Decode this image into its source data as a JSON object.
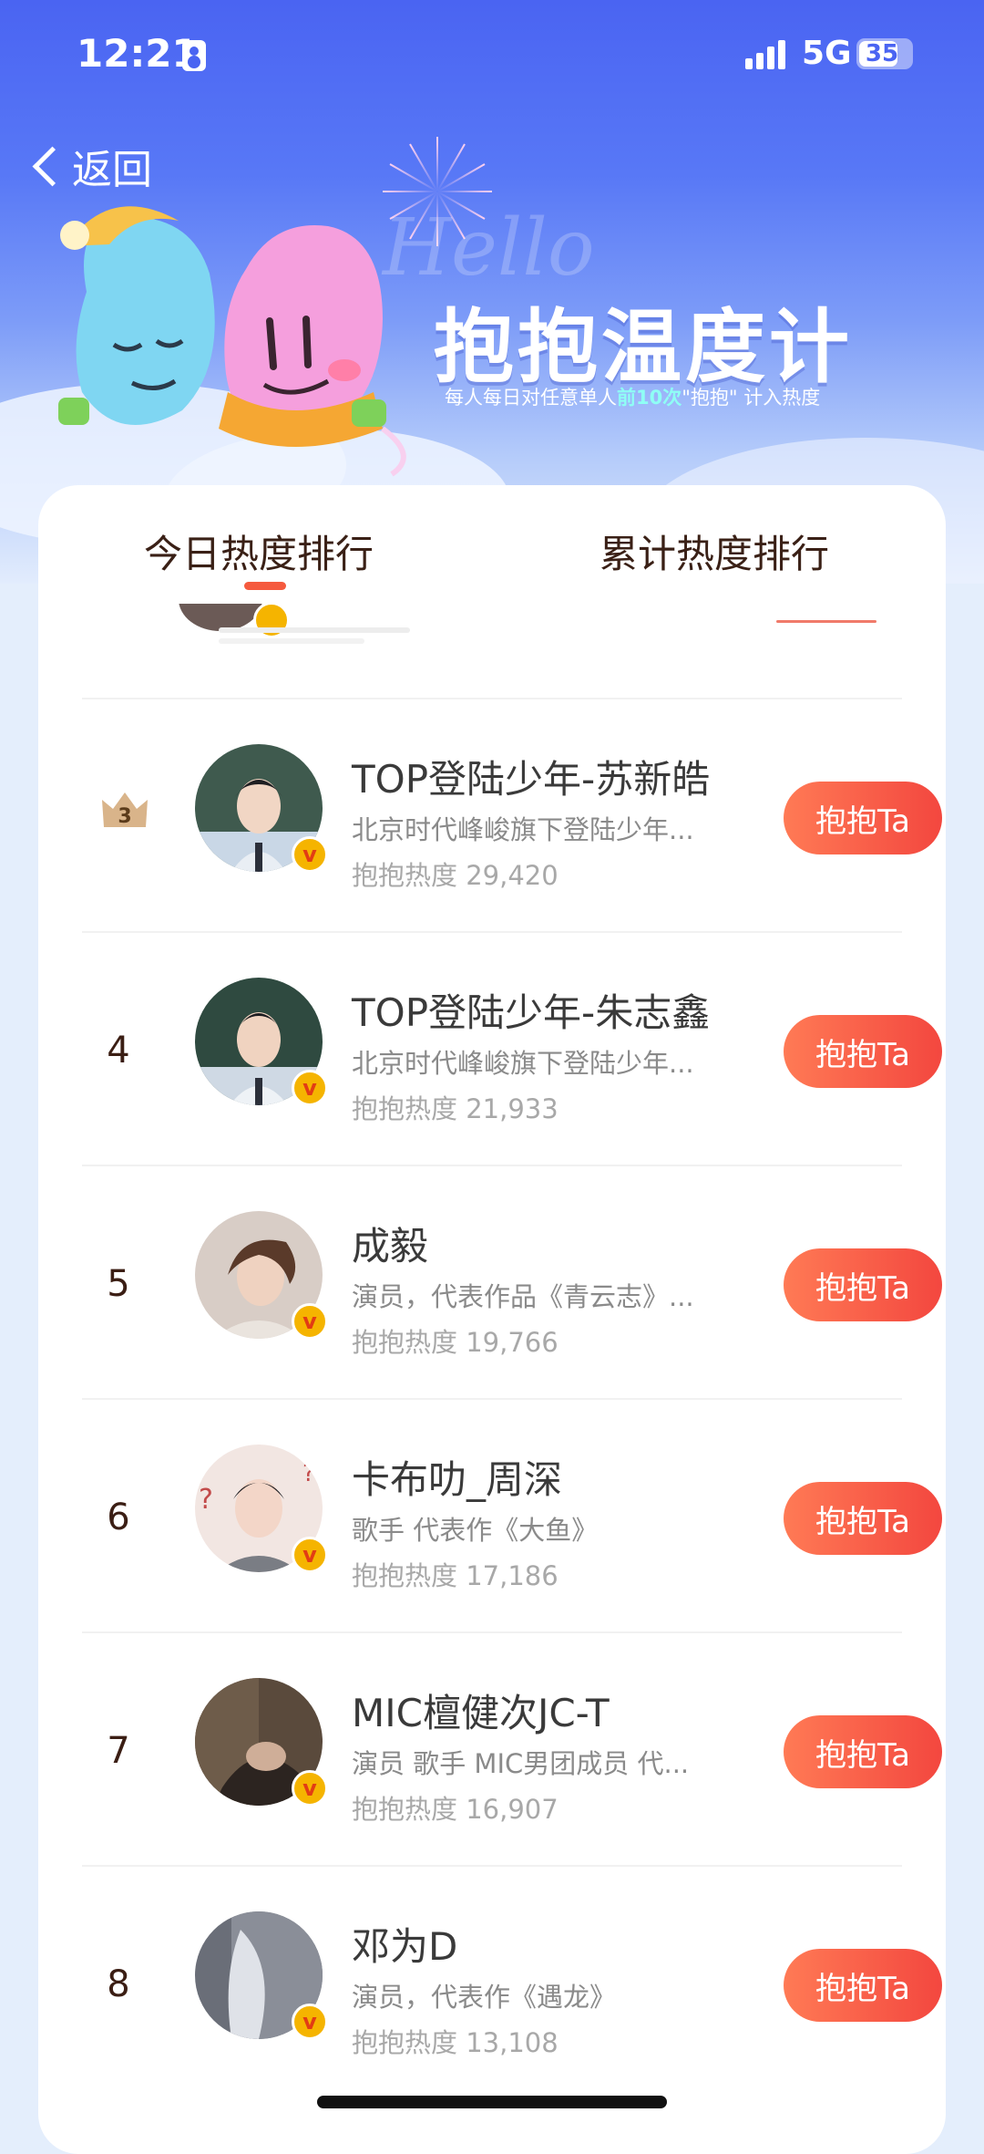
{
  "status": {
    "time": "12:21",
    "network": "5G",
    "battery": "35"
  },
  "nav": {
    "back_label": "返回"
  },
  "hero": {
    "script_text": "Hello",
    "title": "抱抱温度计",
    "subtitle_pre": "每人每日对任意单人",
    "subtitle_highlight": "前10次",
    "subtitle_post": "\"抱抱\" 计入热度"
  },
  "tabs": {
    "today": "今日热度排行",
    "total": "累计热度排行"
  },
  "colors": {
    "accent": "#f55a3e",
    "header": "#4a64f2",
    "button_start": "#ff7a55",
    "button_end": "#f3473f"
  },
  "ranking": [
    {
      "rank": "3",
      "crown": true,
      "name": "TOP登陆少年-苏新皓",
      "desc": "北京时代峰峻旗下登陆少年...",
      "heat": "抱抱热度 29,420",
      "button": "抱抱Ta"
    },
    {
      "rank": "4",
      "crown": false,
      "name": "TOP登陆少年-朱志鑫",
      "desc": "北京时代峰峻旗下登陆少年...",
      "heat": "抱抱热度 21,933",
      "button": "抱抱Ta"
    },
    {
      "rank": "5",
      "crown": false,
      "name": "成毅",
      "desc": "演员，代表作品《青云志》...",
      "heat": "抱抱热度 19,766",
      "button": "抱抱Ta"
    },
    {
      "rank": "6",
      "crown": false,
      "name": "卡布叻_周深",
      "desc": "歌手 代表作《大鱼》",
      "heat": "抱抱热度 17,186",
      "button": "抱抱Ta"
    },
    {
      "rank": "7",
      "crown": false,
      "name": "MIC檀健次JC-T",
      "desc": "演员 歌手 MIC男团成员 代...",
      "heat": "抱抱热度 16,907",
      "button": "抱抱Ta"
    },
    {
      "rank": "8",
      "crown": false,
      "name": "邓为D",
      "desc": "演员，代表作《遇龙》",
      "heat": "抱抱热度 13,108",
      "button": "抱抱Ta"
    }
  ]
}
